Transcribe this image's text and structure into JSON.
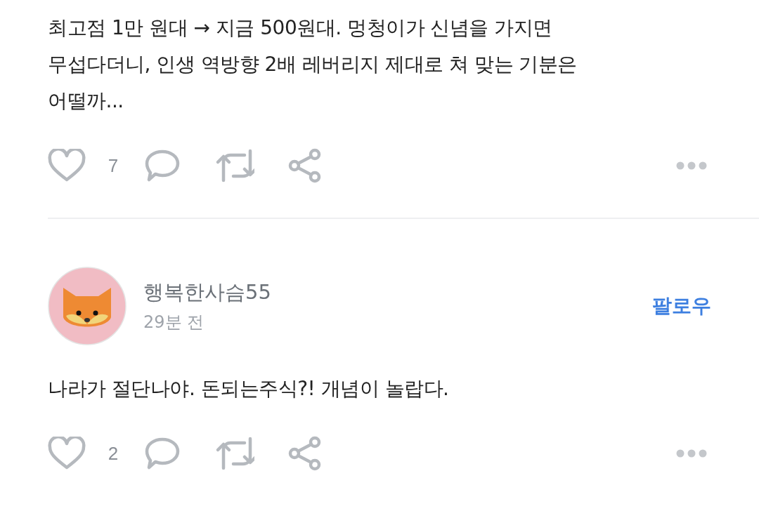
{
  "posts": [
    {
      "text_lines": [
        "최고점 1만 원대 → 지금 500원대. 멍청이가 신념을 가지면",
        "무섭다더니, 인생 역방향 2배 레버리지 제대로 쳐 맞는 기분은",
        "어떨까..."
      ],
      "like_count": "7"
    },
    {
      "author": {
        "name": "행복한사슴55",
        "time": "29분 전",
        "follow_label": "팔로우"
      },
      "text_lines": [
        "나라가 절단나야. 돈되는주식?! 개념이 놀랍다."
      ],
      "like_count": "2"
    }
  ]
}
